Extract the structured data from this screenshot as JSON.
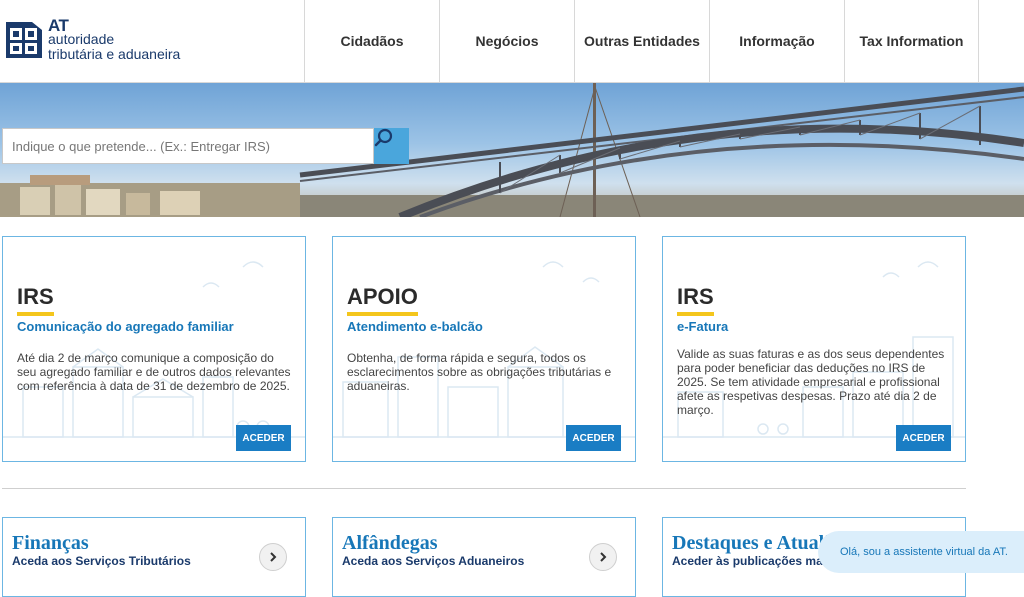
{
  "logo": {
    "line1": "AT",
    "line2": "autoridade",
    "line3": "tributária e aduaneira"
  },
  "nav": [
    {
      "label": "Cidadãos"
    },
    {
      "label": "Negócios"
    },
    {
      "label": "Outras Entidades"
    },
    {
      "label": "Informação"
    },
    {
      "label": "Tax Information"
    }
  ],
  "search": {
    "placeholder": "Indique o que pretende... (Ex.: Entregar IRS)"
  },
  "cards": [
    {
      "kicker": "IRS",
      "subtitle": "Comunicação do agregado familiar",
      "text": "Até dia 2 de março comunique a composição do seu agregado familiar e de outros dados relevantes com referência à data de 31 de dezembro de 2025.",
      "button": "ACEDER"
    },
    {
      "kicker": "APOIO",
      "subtitle": "Atendimento e-balcão",
      "text": "Obtenha, de forma rápida e segura, todos os esclarecimentos sobre as obrigações tributárias e aduaneiras.",
      "button": "ACEDER"
    },
    {
      "kicker": "IRS",
      "subtitle": "e-Fatura",
      "text": "Valide as suas faturas e as dos seus dependentes para poder beneficiar das deduções no IRS de 2025. Se tem atividade empresarial e profissional afete as respetivas despesas. Prazo até dia 2 de março.",
      "button": "ACEDER"
    }
  ],
  "bottom_cards": [
    {
      "title": "Finanças",
      "subtitle": "Aceda aos Serviços Tributários"
    },
    {
      "title": "Alfândegas",
      "subtitle": "Aceda aos Serviços Aduaneiros"
    },
    {
      "title": "Destaques e Atualidade",
      "subtitle": "Aceder às publicações mais recentes"
    }
  ],
  "assistant": {
    "text": "Olá, sou a assistente virtual da AT."
  },
  "colors": {
    "accent": "#1a7dc4",
    "highlight": "#f4c61c",
    "brand": "#1a3a6b"
  }
}
